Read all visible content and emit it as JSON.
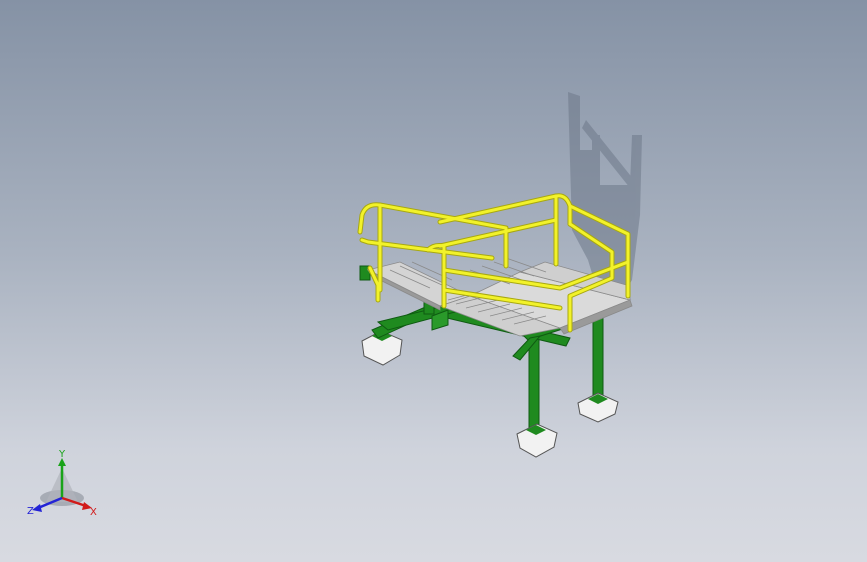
{
  "viewport": {
    "background_top": "#8592a5",
    "background_bottom": "#d8dae1"
  },
  "model": {
    "colors": {
      "railing": "#f2f22a",
      "railing_edge": "#a8a810",
      "steel": "#1f8a1f",
      "steel_dark": "#0f5a12",
      "tread": "#d4d4d4",
      "tread_edge": "#8a8a8a",
      "footing": "#f2f2f2",
      "shadow": "#6d7889"
    }
  },
  "triad": {
    "x_label": "X",
    "y_label": "Y",
    "z_label": "Z",
    "x_color": "#d11a1a",
    "y_color": "#19a319",
    "z_color": "#2323d6"
  }
}
